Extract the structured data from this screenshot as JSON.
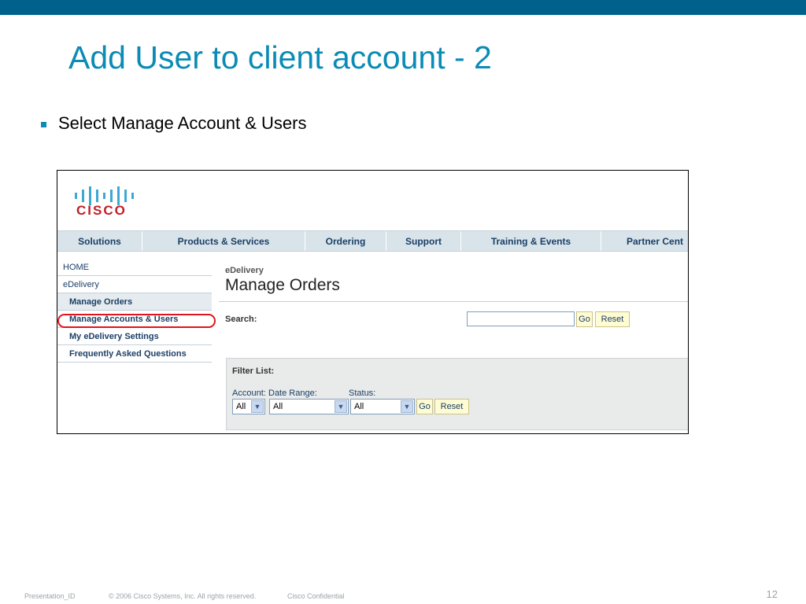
{
  "slide": {
    "title": "Add User to client account - 2",
    "bullet": "Select Manage Account & Users",
    "footer": {
      "presentation_id": "Presentation_ID",
      "copyright": "© 2006 Cisco Systems, Inc. All rights reserved.",
      "confidential": "Cisco Confidential",
      "page_number": "12"
    },
    "colors": {
      "topbar": "#00628c",
      "title": "#0b8bb5",
      "highlight": "#e0141e"
    }
  },
  "screenshot": {
    "logo": {
      "icon": "cisco-bars-icon",
      "text": "CISCO"
    },
    "nav": [
      "Solutions",
      "Products & Services",
      "Ordering",
      "Support",
      "Training & Events",
      "Partner Cent"
    ],
    "sidebar": {
      "home": "HOME",
      "section": "eDelivery",
      "items": [
        "Manage Orders",
        "Manage Accounts & Users",
        "My eDelivery Settings",
        "Frequently Asked Questions"
      ]
    },
    "breadcrumb": "eDelivery",
    "page_title": "Manage Orders",
    "search": {
      "label": "Search:",
      "value": "",
      "go": "Go",
      "reset": "Reset"
    },
    "filter": {
      "title": "Filter List:",
      "account_label": "Account:",
      "date_range_label": "Date Range:",
      "status_label": "Status:",
      "account_value": "All",
      "date_range_value": "All",
      "status_value": "All",
      "go": "Go",
      "reset": "Reset"
    }
  }
}
